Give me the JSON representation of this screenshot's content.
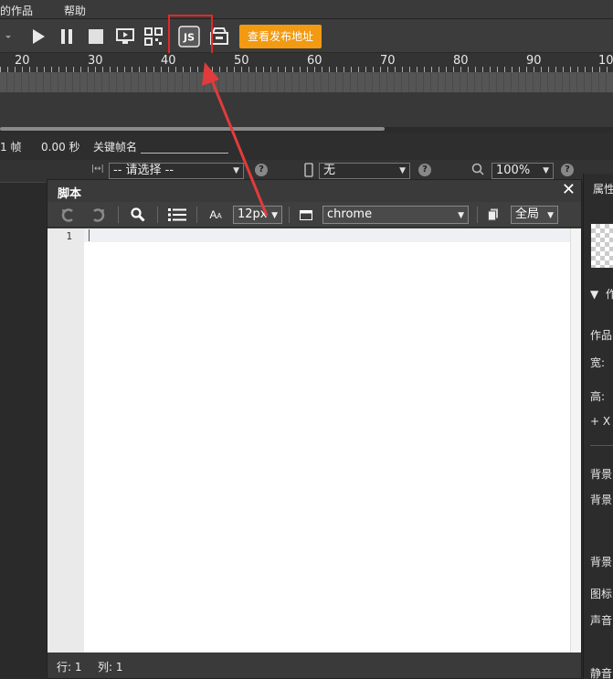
{
  "menu": {
    "works_fragment": "的作品",
    "help": "帮助"
  },
  "toolbar": {
    "publish_label": "查看发布地址",
    "js_icon": "js-script-icon"
  },
  "ruler": {
    "marks": [
      "20",
      "30",
      "40",
      "50",
      "60",
      "70",
      "80",
      "90",
      "10"
    ]
  },
  "status": {
    "frame_fragment": "1 帧",
    "time": "0.00 秒",
    "keyframe_label": "关键帧名"
  },
  "propbar": {
    "select_placeholder": "-- 请选择 --",
    "device_value": "无",
    "zoom_value": "100%"
  },
  "right_panel": {
    "properties_fragment": "属性",
    "section_fragment": "作",
    "work_fragment": "作品",
    "width_label": "宽:",
    "height_label": "高:",
    "x_fragment": "+  X",
    "bg1": "背景",
    "bg2": "背景",
    "bg3": "背景",
    "icon_fragment": "图标",
    "sound_fragment": "声音",
    "mute_fragment": "静音"
  },
  "dialog": {
    "title": "脚本",
    "font_size": "12px",
    "theme": "chrome",
    "scope": "全局",
    "line_number": "1",
    "status_row": "行: 1",
    "status_col": "列: 1"
  },
  "colors": {
    "publish_button": "#f29a12",
    "highlight": "#e2282a",
    "arrow": "#e23b3b"
  }
}
